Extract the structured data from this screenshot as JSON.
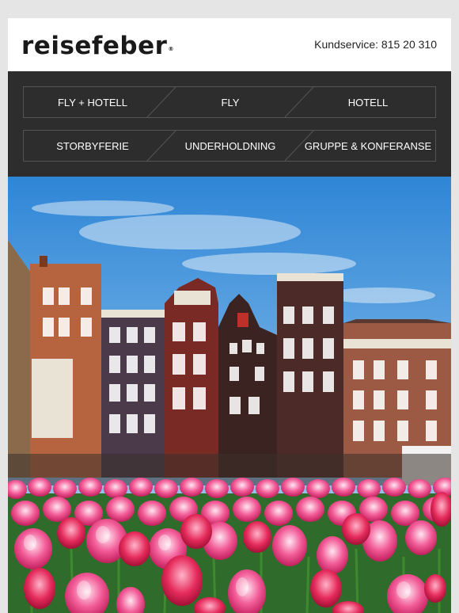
{
  "brand": {
    "logo_text": "reisefeber",
    "trademark": "®"
  },
  "header": {
    "customer_service": "Kundservice: 815 20 310"
  },
  "nav": {
    "row1": [
      "FLY + HOTELL",
      "FLY",
      "HOTELL"
    ],
    "row2": [
      "STORBYFERIE",
      "UNDERHOLDNING",
      "GRUPPE & KONFERANSE"
    ]
  },
  "hero": {
    "image": "amsterdam-canal-houses-with-tulips"
  },
  "colors": {
    "nav_bg": "#2d2d2d",
    "page_bg": "#e5e5e5",
    "accent": "#ffffff"
  }
}
